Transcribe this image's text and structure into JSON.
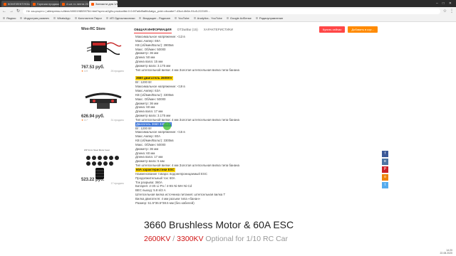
{
  "browser": {
    "tabs": [
      {
        "label": "КОМПЛЕКТУЮЩИЕ — Радиоупр",
        "active": false
      },
      {
        "label": "Горячая продажа WP 3CE води",
        "active": false
      },
      {
        "label": "4 шт. rc лента 20 кг DS3218 ко",
        "active": false
      },
      {
        "label": "Запчасти для 1/10 автомобилей",
        "active": true
      }
    ],
    "url_security": "Не защищено",
    "url": "aliexpress.ru/item/4000198539754.html?spm=a2g0o.productlist.0.0.6f7a6d5a8fc&algo_pvid=cfccabe7-43cd-4b6e-91c5-222105...",
    "bookmarks": [
      "Яндекс",
      "Индустрия развлеч",
      "WhatsApp",
      "Константин Пирог",
      "ИП Одноклассники",
      "Входящие - Радиоап",
      "YouTube",
      "Analytics - YouTube",
      "Google AdSense",
      "Радиоуправление"
    ]
  },
  "sidebar": {
    "store": "Woo-RC Store",
    "products": [
      {
        "price": "767.53 руб.",
        "rating": "4.9",
        "orders": "26 продано"
      },
      {
        "price": "626.94 руб.",
        "rating": "4.7",
        "orders": "31 продано"
      },
      {
        "price": "523.22 руб.",
        "rating": "",
        "orders": "17 продано"
      },
      {
        "price": "",
        "rating": "",
        "orders": ""
      }
    ],
    "third_image_caption": "WP 3mm Steel Motor Gear"
  },
  "product_tabs": [
    "ОБЩАЯ ИНФОРМАЦИЯ",
    "ОТЗЫВЫ (15)",
    "ХАРАКТЕРИСТИКИ"
  ],
  "buttons": {
    "buy": "Купить сейчас",
    "cart": "Добавить в кор..."
  },
  "content": {
    "lines": [
      {
        "text": "Максимальное напряжение: <13 в",
        "style": "normal"
      },
      {
        "text": "Макс.Ампер: 69A",
        "style": "normal"
      },
      {
        "text": "KB (об/мин/Вольт): 3900кв",
        "style": "normal"
      },
      {
        "text": "Макс. Об/мин: 50000",
        "style": "normal"
      },
      {
        "text": "Диаметр: 36 мм",
        "style": "normal"
      },
      {
        "text": "Длина: 50 мм",
        "style": "normal"
      },
      {
        "text": "Длина вала: 15 мм",
        "style": "normal"
      },
      {
        "text": "Диаметр вала: 3.175 мм",
        "style": "normal"
      },
      {
        "text": "Тип штепсельной вилки: 4 мм Золотая штепсельная вилка типа банана",
        "style": "normal"
      },
      {
        "text": "",
        "style": "normal"
      },
      {
        "text": "3660 двигатель 2600KV",
        "style": "hl"
      },
      {
        "text": "Вт: 1200 Вт",
        "style": "normal"
      },
      {
        "text": "Максимальное напряжение: <19 в",
        "style": "normal"
      },
      {
        "text": "Макс.Ампер: 63A",
        "style": "normal"
      },
      {
        "text": "KB (об/мин/Вольт): 3300кв",
        "style": "normal"
      },
      {
        "text": "Макс. Об/мин: 50000",
        "style": "normal"
      },
      {
        "text": "Диаметр: 36 мм",
        "style": "normal"
      },
      {
        "text": "Длина: 60 мм",
        "style": "normal"
      },
      {
        "text": "Длина вала: 17 мм",
        "style": "normal"
      },
      {
        "text": "Диаметр вала: 3.175 мм",
        "style": "normal"
      },
      {
        "text": "Тип штепсельной вилки: 4 мм Золотая штепсельная вилка типа банана",
        "style": "normal"
      },
      {
        "text": "Двигатель 3660 3300KV",
        "style": "sel"
      },
      {
        "text": "Вт: 1200 Вт",
        "style": "normal"
      },
      {
        "text": "Максимальное напряжение: <15 в",
        "style": "normal"
      },
      {
        "text": "Макс.Ампер: 80A",
        "style": "normal"
      },
      {
        "text": "KB (об/мин/Вольт): 3300кв",
        "style": "normal"
      },
      {
        "text": "Макс. Об/мин: 50000",
        "style": "normal"
      },
      {
        "text": "Диаметр: 36 мм",
        "style": "normal"
      },
      {
        "text": "Длина: 60 мм",
        "style": "normal"
      },
      {
        "text": "Длина вала: 17 мм",
        "style": "normal"
      },
      {
        "text": "Диаметр вала: 5 мм",
        "style": "normal"
      },
      {
        "text": "Тип штепсельной вилки: 4 мм Золотая штепсельная вилка типа банана",
        "style": "normal"
      },
      {
        "text": "60A характеристики ESC",
        "style": "hl"
      },
      {
        "text": "Наименование товара: водонепроницаемый ESC",
        "style": "normal"
      },
      {
        "text": "Продолжительный ток: 60A",
        "style": "normal"
      },
      {
        "text": "Ток разрыва: 360A",
        "style": "normal"
      },
      {
        "text": "Батарея: 2-3S Li-Po / 4-9S Ni-MH Ni-Cd",
        "style": "normal"
      },
      {
        "text": "BEC выход: 5.8 в/3 А",
        "style": "normal"
      },
      {
        "text": "Штепсельная вилка источника питания: штепсельная вилка T",
        "style": "normal"
      },
      {
        "text": "Вилка двигателя: 4 мм разъем типа «банан»",
        "style": "normal"
      },
      {
        "text": "Размер: 51.5*36.5*38.5 мм (без кабелей)",
        "style": "normal"
      }
    ]
  },
  "overlay": {
    "title": "3660 Brushless Motor & 60A ESC",
    "kv1": "2600KV",
    "sep": " / ",
    "kv2": "3300KV",
    "tail": "  Optional for 1/10 RC Car"
  },
  "clock": {
    "time": "14:20",
    "date": "22.08.2020"
  },
  "colors": {
    "accent": "#ff4747",
    "highlight": "#ffd400",
    "selection": "#3b73d6",
    "overlay_red": "#d01414"
  }
}
